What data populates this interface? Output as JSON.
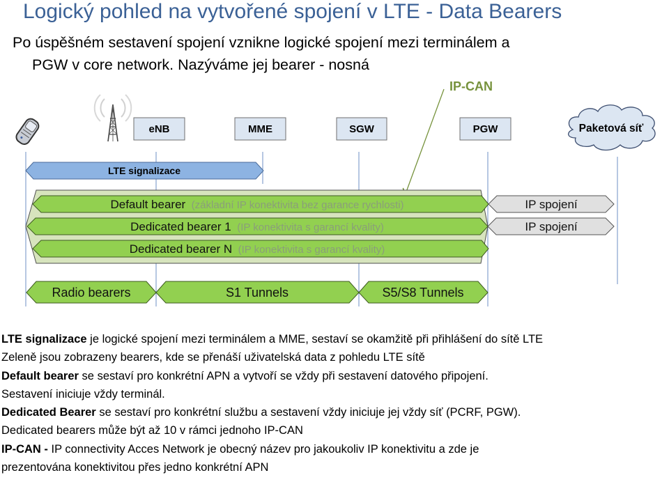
{
  "slide": {
    "title": "Logický pohled na vytvořené spojení v LTE - Data Bearers",
    "subtitle_line1": "Po úspěšném sestavení spojení vznikne logické spojení mezi terminálem a",
    "subtitle_line2": "PGW v core network. Nazýváme jej bearer - nosná"
  },
  "diagram": {
    "ipcan_label": "IP-CAN",
    "nodes": {
      "ue_icon": "mobile-phone-icon",
      "tower_icon": "radio-tower-icon",
      "enb": "eNB",
      "mme": "MME",
      "sgw": "SGW",
      "pgw": "PGW",
      "cloud": "Paketová síť"
    },
    "signaling": "LTE signalizace",
    "bearers": [
      {
        "main": "Default bearer",
        "note": "(základní IP konektivita bez garance rychlosti)"
      },
      {
        "main": "Dedicated bearer 1",
        "note": "(IP konektivita s garancí kvality)"
      },
      {
        "main": "Dedicated bearer N",
        "note": "(IP konektivita s garancí kvality)"
      }
    ],
    "ip_connections": [
      "IP spojení",
      "IP spojení"
    ],
    "tunnels": [
      "Radio bearers",
      "S1 Tunnels",
      "S5/S8 Tunnels"
    ],
    "colors": {
      "title": "#3b6196",
      "node_fill": "#dce6f2",
      "node_border": "#6f6f6f",
      "lifeline": "#6d8fc4",
      "signaling_fill": "#8db3e2",
      "bearer_fill": "#92d050",
      "container_fill": "#d7e4bd",
      "ip_fill": "#e0e0e0",
      "ipcan": "#76923c"
    }
  },
  "notes": [
    {
      "bold": "LTE signalizace",
      "text": " je logické spojení mezi terminálem a MME, sestaví se okamžitě při přihlášení do sítě LTE"
    },
    {
      "bold": "",
      "text": "Zeleně jsou zobrazeny bearers, kde se přenáší uživatelská data z pohledu LTE sítě"
    },
    {
      "bold": "Default bearer",
      "text": " se sestaví pro konkrétní APN a vytvoří se vždy při sestavení datového připojení."
    },
    {
      "bold": "",
      "text": "Sestavení iniciuje vždy terminál."
    },
    {
      "bold": "Dedicated Bearer",
      "text": " se sestaví pro konkrétní službu a sestavení vždy iniciuje jej vždy síť (PCRF, PGW)."
    },
    {
      "bold": "",
      "text": "Dedicated bearers může být až 10 v rámci jednoho IP-CAN"
    },
    {
      "bold": "IP-CAN -",
      "text": " IP connectivity Acces Network je obecný název pro jakoukoliv IP konektivitu a zde je"
    },
    {
      "bold": "",
      "text": "prezentována konektivitou přes jedno konkrétní APN"
    }
  ]
}
